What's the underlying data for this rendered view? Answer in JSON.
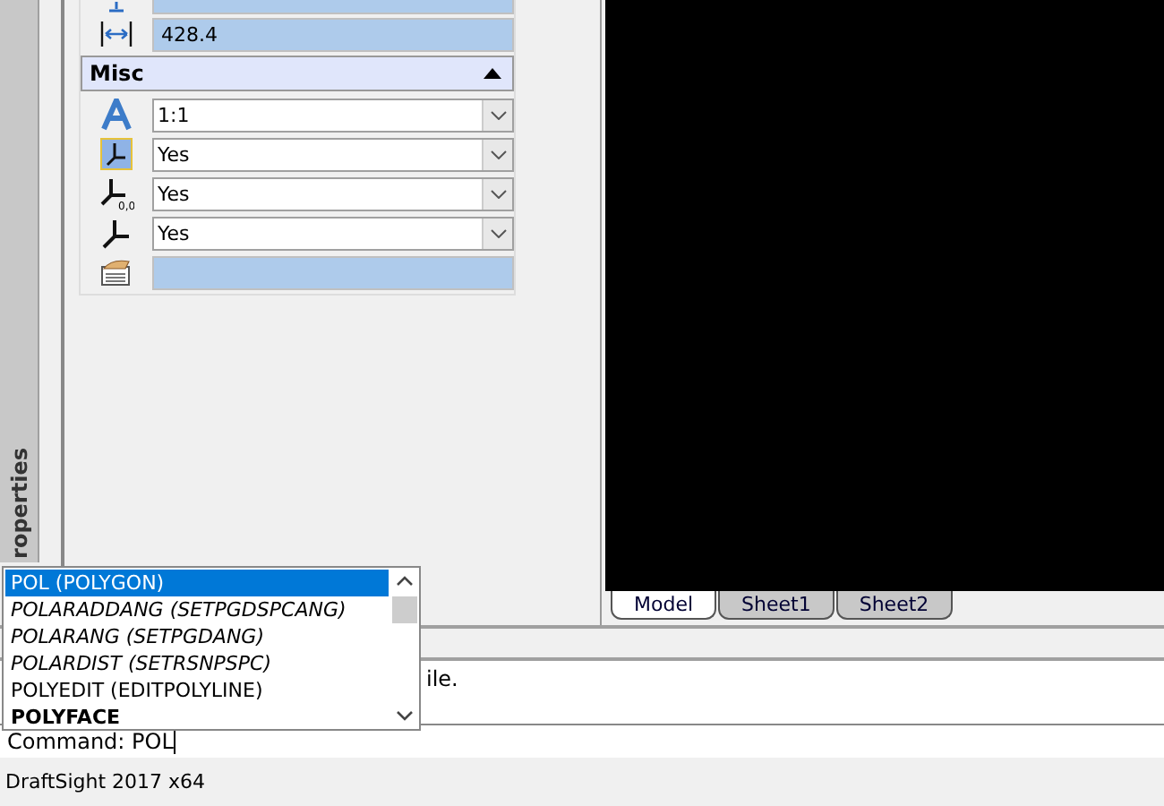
{
  "side_tab": {
    "label": "roperties"
  },
  "properties": {
    "top_rows": [
      {
        "kind": "field"
      },
      {
        "kind": "field",
        "value": "428.4"
      }
    ],
    "section": {
      "title": "Misc",
      "expanded": true,
      "rows": [
        {
          "kind": "select",
          "value": "1:1"
        },
        {
          "kind": "select",
          "value": "Yes"
        },
        {
          "kind": "select",
          "value": "Yes",
          "icon_text": "0,0"
        },
        {
          "kind": "select",
          "value": "Yes"
        },
        {
          "kind": "field"
        }
      ]
    }
  },
  "layout_tabs": [
    {
      "label": "Model",
      "selected": true
    },
    {
      "label": "Sheet1",
      "selected": false
    },
    {
      "label": "Sheet2",
      "selected": false
    }
  ],
  "command_history": [
    "ile."
  ],
  "command_line": {
    "prompt": "Command:",
    "value": "POL"
  },
  "autocomplete": [
    {
      "label": "POL (POLYGON)",
      "kind": "normal",
      "selected": true
    },
    {
      "label": "POLARADDANG (SETPGDSPCANG)",
      "kind": "italic",
      "selected": false
    },
    {
      "label": "POLARANG (SETPGDANG)",
      "kind": "italic",
      "selected": false
    },
    {
      "label": "POLARDIST (SETRSNPSPC)",
      "kind": "italic",
      "selected": false
    },
    {
      "label": "POLYEDIT (EDITPOLYLINE)",
      "kind": "normal",
      "selected": false
    },
    {
      "label": "POLYFACE",
      "kind": "bold",
      "selected": false
    }
  ],
  "status_bar": {
    "text": "DraftSight 2017 x64"
  }
}
